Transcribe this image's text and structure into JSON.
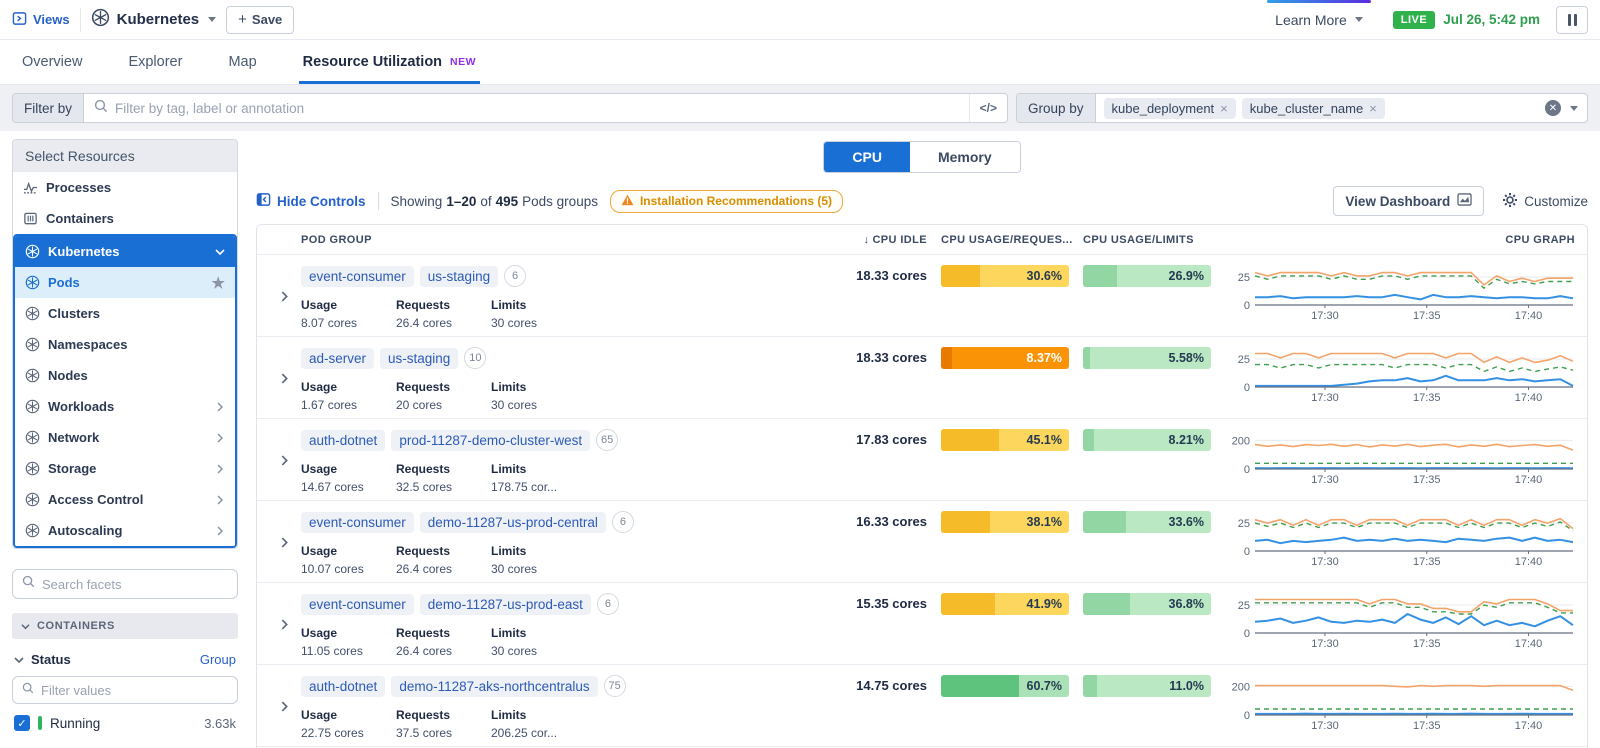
{
  "topbar": {
    "views_label": "Views",
    "context_name": "Kubernetes",
    "save_label": "Save",
    "learn_more_label": "Learn More",
    "live_label": "LIVE",
    "timestamp": "Jul 26, 5:42 pm"
  },
  "tabs": [
    {
      "label": "Overview",
      "active": false
    },
    {
      "label": "Explorer",
      "active": false
    },
    {
      "label": "Map",
      "active": false
    },
    {
      "label": "Resource Utilization",
      "badge": "NEW",
      "active": true
    }
  ],
  "filter_bar": {
    "filter_by_label": "Filter by",
    "search_placeholder": "Filter by tag, label or annotation",
    "code_toggle_label": "</>",
    "group_by_label": "Group by",
    "group_pills": [
      "kube_deployment",
      "kube_cluster_name"
    ]
  },
  "sidebar": {
    "header": "Select Resources",
    "top_items": [
      {
        "label": "Processes"
      },
      {
        "label": "Containers"
      }
    ],
    "kubernetes_group": {
      "label": "Kubernetes",
      "items": [
        {
          "label": "Pods",
          "selected": true,
          "starred": true
        },
        {
          "label": "Clusters"
        },
        {
          "label": "Namespaces"
        },
        {
          "label": "Nodes"
        },
        {
          "label": "Workloads",
          "expandable": true
        },
        {
          "label": "Network",
          "expandable": true
        },
        {
          "label": "Storage",
          "expandable": true
        },
        {
          "label": "Access Control",
          "expandable": true
        },
        {
          "label": "Autoscaling",
          "expandable": true
        }
      ]
    },
    "facet_search_placeholder": "Search facets",
    "containers_section_label": "CONTAINERS",
    "status_facet": {
      "label": "Status",
      "group_link": "Group",
      "filter_placeholder": "Filter values",
      "values": [
        {
          "label": "Running",
          "count": "3.63k",
          "checked": true
        }
      ]
    }
  },
  "main": {
    "metric_toggle": {
      "options": [
        "CPU",
        "Memory"
      ],
      "active": "CPU"
    },
    "controls": {
      "hide_controls_label": "Hide Controls",
      "showing_prefix": "Showing",
      "showing_range": "1–20",
      "showing_of": "of",
      "showing_total": "495",
      "showing_suffix": "Pods groups",
      "recommendations_label": "Installation Recommendations (5)",
      "view_dashboard_label": "View Dashboard",
      "customize_label": "Customize"
    },
    "table": {
      "columns": {
        "pod_group": "POD GROUP",
        "cpu_idle": "CPU IDLE",
        "cpu_usage_requests": "CPU USAGE/REQUES...",
        "cpu_usage_limits": "CPU USAGE/LIMITS",
        "cpu_graph": "CPU GRAPH"
      },
      "detail_labels": [
        "Usage",
        "Requests",
        "Limits"
      ],
      "rows": [
        {
          "name": "event-consumer",
          "cluster": "us-staging",
          "count": "6",
          "usage": "8.07 cores",
          "requests": "26.4 cores",
          "limits": "30 cores",
          "cpu_idle": "18.33 cores",
          "usage_requests": {
            "pct": 30.6,
            "label": "30.6%",
            "tone": "yellow"
          },
          "usage_limits": {
            "pct": 26.9,
            "label": "26.9%",
            "tone": "green"
          },
          "graph": {
            "ymax": 25,
            "ymax_label": "25",
            "scale_max": 34,
            "xticks": [
              "17:30",
              "17:35",
              "17:40"
            ],
            "limits": [
              29,
              26,
              29,
              29,
              29,
              29,
              26,
              29,
              26,
              26,
              29,
              29,
              26,
              29,
              29,
              29,
              29,
              29,
              18,
              26,
              21,
              24,
              21,
              24,
              24,
              24
            ],
            "requests": [
              26,
              23,
              26,
              26,
              26,
              26,
              23,
              26,
              23,
              23,
              26,
              26,
              23,
              26,
              26,
              26,
              26,
              26,
              15,
              23,
              19,
              21,
              19,
              21,
              21,
              21
            ],
            "usage": [
              7,
              7,
              8,
              6,
              7,
              7,
              7,
              7,
              8,
              7,
              7,
              9,
              7,
              5,
              9,
              7,
              7,
              8,
              7,
              6,
              7,
              7,
              6,
              6,
              8,
              6
            ]
          }
        },
        {
          "name": "ad-server",
          "cluster": "us-staging",
          "count": "10",
          "usage": "1.67 cores",
          "requests": "20 cores",
          "limits": "30 cores",
          "cpu_idle": "18.33 cores",
          "usage_requests": {
            "pct": 8.37,
            "label": "8.37%",
            "tone": "orange"
          },
          "usage_limits": {
            "pct": 5.58,
            "label": "5.58%",
            "tone": "green"
          },
          "graph": {
            "ymax": 25,
            "ymax_label": "25",
            "scale_max": 34,
            "xticks": [
              "17:30",
              "17:35",
              "17:40"
            ],
            "limits": [
              30,
              30,
              26,
              30,
              30,
              26,
              30,
              30,
              30,
              30,
              30,
              26,
              30,
              30,
              30,
              26,
              30,
              30,
              22,
              27,
              22,
              26,
              22,
              24,
              28,
              23
            ],
            "requests": [
              20,
              20,
              17,
              20,
              20,
              17,
              20,
              20,
              20,
              20,
              20,
              17,
              20,
              20,
              20,
              17,
              20,
              20,
              14,
              18,
              14,
              17,
              14,
              16,
              18,
              15
            ],
            "usage": [
              1,
              1,
              1,
              1,
              1,
              1,
              1,
              2,
              3,
              5,
              6,
              6,
              8,
              5,
              6,
              10,
              6,
              6,
              6,
              8,
              6,
              7,
              5,
              6,
              7,
              1
            ]
          }
        },
        {
          "name": "auth-dotnet",
          "cluster": "prod-11287-demo-cluster-west",
          "count": "65",
          "usage": "14.67 cores",
          "requests": "32.5 cores",
          "limits": "178.75 cor...",
          "cpu_idle": "17.83 cores",
          "usage_requests": {
            "pct": 45.1,
            "label": "45.1%",
            "tone": "yellow"
          },
          "usage_limits": {
            "pct": 8.21,
            "label": "8.21%",
            "tone": "green"
          },
          "graph": {
            "ymax": 200,
            "ymax_label": "200",
            "scale_max": 265,
            "xticks": [
              "17:30",
              "17:35",
              "17:40"
            ],
            "limits": [
              170,
              158,
              168,
              156,
              170,
              164,
              172,
              158,
              170,
              154,
              168,
              160,
              172,
              156,
              166,
              172,
              154,
              168,
              158,
              172,
              156,
              164,
              170,
              158,
              166,
              132
            ],
            "requests": [
              40,
              40,
              40,
              40,
              40,
              40,
              40,
              40,
              40,
              40,
              40,
              40,
              40,
              40,
              40,
              40,
              40,
              40,
              40,
              40,
              40,
              40,
              40,
              40,
              40,
              40
            ],
            "usage": [
              6,
              5,
              6,
              6,
              5,
              6,
              6,
              5,
              6,
              6,
              5,
              6,
              6,
              5,
              6,
              6,
              5,
              6,
              6,
              5,
              6,
              6,
              5,
              6,
              6,
              5
            ]
          }
        },
        {
          "name": "event-consumer",
          "cluster": "demo-11287-us-prod-central",
          "count": "6",
          "usage": "10.07 cores",
          "requests": "26.4 cores",
          "limits": "30 cores",
          "cpu_idle": "16.33 cores",
          "usage_requests": {
            "pct": 38.1,
            "label": "38.1%",
            "tone": "yellow"
          },
          "usage_limits": {
            "pct": 33.6,
            "label": "33.6%",
            "tone": "green"
          },
          "graph": {
            "ymax": 25,
            "ymax_label": "25",
            "scale_max": 34,
            "xticks": [
              "17:30",
              "17:35",
              "17:40"
            ],
            "limits": [
              28,
              25,
              28,
              23,
              28,
              23,
              28,
              28,
              23,
              28,
              28,
              28,
              23,
              28,
              28,
              28,
              23,
              28,
              23,
              28,
              28,
              23,
              28,
              25,
              29,
              20
            ],
            "requests": [
              25,
              22,
              25,
              21,
              25,
              21,
              25,
              25,
              21,
              25,
              25,
              25,
              21,
              25,
              25,
              25,
              21,
              25,
              21,
              25,
              25,
              21,
              25,
              22,
              26,
              18
            ],
            "usage": [
              9,
              10,
              7,
              9,
              8,
              9,
              10,
              12,
              9,
              10,
              9,
              11,
              9,
              10,
              9,
              8,
              11,
              10,
              9,
              11,
              12,
              9,
              12,
              9,
              10,
              8
            ]
          }
        },
        {
          "name": "event-consumer",
          "cluster": "demo-11287-us-prod-east",
          "count": "6",
          "usage": "11.05 cores",
          "requests": "26.4 cores",
          "limits": "30 cores",
          "cpu_idle": "15.35 cores",
          "usage_requests": {
            "pct": 41.9,
            "label": "41.9%",
            "tone": "yellow"
          },
          "usage_limits": {
            "pct": 36.8,
            "label": "36.8%",
            "tone": "green"
          },
          "graph": {
            "ymax": 25,
            "ymax_label": "25",
            "scale_max": 34,
            "xticks": [
              "17:30",
              "17:35",
              "17:40"
            ],
            "limits": [
              30,
              30,
              30,
              30,
              30,
              30,
              30,
              30,
              30,
              26,
              30,
              30,
              26,
              26,
              22,
              22,
              19,
              19,
              28,
              26,
              30,
              30,
              30,
              26,
              20,
              20
            ],
            "requests": [
              27,
              27,
              27,
              27,
              27,
              27,
              27,
              27,
              27,
              23,
              27,
              27,
              23,
              23,
              19,
              19,
              17,
              17,
              25,
              23,
              27,
              27,
              27,
              23,
              18,
              18
            ],
            "usage": [
              10,
              11,
              13,
              9,
              11,
              14,
              10,
              9,
              11,
              10,
              12,
              9,
              17,
              12,
              9,
              14,
              8,
              15,
              7,
              11,
              7,
              9,
              6,
              11,
              15,
              7
            ]
          }
        },
        {
          "name": "auth-dotnet",
          "cluster": "demo-11287-aks-northcentralus",
          "count": "75",
          "usage": "22.75 cores",
          "requests": "37.5 cores",
          "limits": "206.25 cor...",
          "cpu_idle": "14.75 cores",
          "usage_requests": {
            "pct": 60.7,
            "label": "60.7%",
            "tone": "green-strong"
          },
          "usage_limits": {
            "pct": 11.0,
            "label": "11.0%",
            "tone": "green"
          },
          "graph": {
            "ymax": 200,
            "ymax_label": "200",
            "scale_max": 265,
            "xticks": [
              "17:30",
              "17:35",
              "17:40"
            ],
            "limits": [
              205,
              205,
              205,
              205,
              205,
              205,
              205,
              205,
              205,
              205,
              205,
              200,
              196,
              205,
              200,
              205,
              205,
              205,
              200,
              205,
              205,
              205,
              205,
              205,
              205,
              172
            ],
            "requests": [
              42,
              42,
              42,
              42,
              42,
              42,
              42,
              42,
              42,
              42,
              42,
              42,
              42,
              42,
              42,
              42,
              42,
              42,
              42,
              42,
              42,
              42,
              42,
              42,
              42,
              42
            ],
            "usage": [
              8,
              8,
              8,
              8,
              10,
              8,
              8,
              9,
              8,
              8,
              8,
              9,
              8,
              8,
              9,
              8,
              8,
              10,
              8,
              8,
              8,
              9,
              8,
              8,
              8,
              8
            ]
          }
        }
      ]
    }
  },
  "colors": {
    "accent_blue": "#1a6fd4",
    "link_blue": "#2461c9",
    "live_green": "#2fb14c",
    "new_purple": "#8f2fe8",
    "warning_orange": "#d98d00",
    "graph_limits_orange": "#f4a369",
    "graph_requests_green": "#3e9e4f",
    "graph_usage_blue": "#3490e3",
    "bar_yellow": "#f6bb28",
    "bar_orange": "#e97a00",
    "bar_green": "#92d6a4",
    "bar_green_strong": "#5ec47d"
  }
}
